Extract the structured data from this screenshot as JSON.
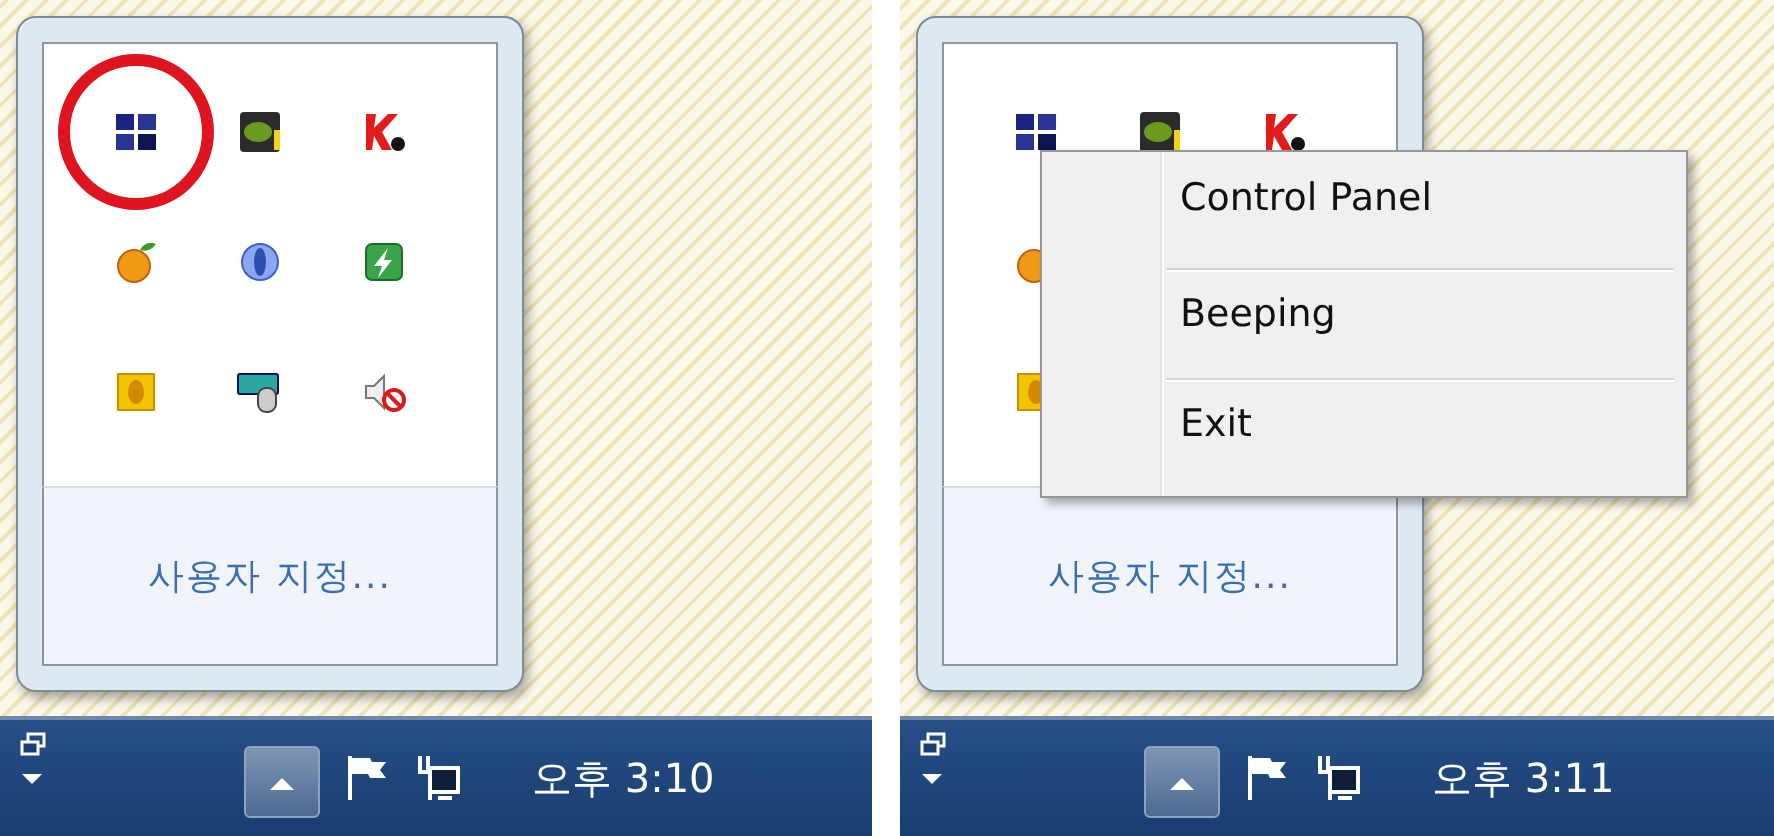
{
  "panels": [
    {
      "circled_first_icon": true,
      "tray_rows": [
        [
          {
            "kind": "grid"
          },
          {
            "kind": "gpu"
          },
          {
            "kind": "antivirus"
          }
        ],
        [
          {
            "kind": "orange"
          },
          {
            "kind": "globe"
          },
          {
            "kind": "bolt"
          }
        ],
        [
          {
            "kind": "folder"
          },
          {
            "kind": "keyboard"
          },
          {
            "kind": "mute"
          }
        ]
      ],
      "customize_link": "사용자 지정...",
      "clock": "오후 3:10"
    },
    {
      "circled_first_icon": false,
      "tray_rows": [
        [
          {
            "kind": "grid"
          },
          {
            "kind": "gpu"
          },
          {
            "kind": "antivirus"
          }
        ],
        [
          {
            "kind": "orange"
          }
        ],
        [
          {
            "kind": "folder"
          }
        ]
      ],
      "customize_link": "사용자 지정...",
      "clock": "오후 3:11",
      "context_menu": [
        "Control Panel",
        "Beeping",
        "Exit"
      ]
    }
  ]
}
